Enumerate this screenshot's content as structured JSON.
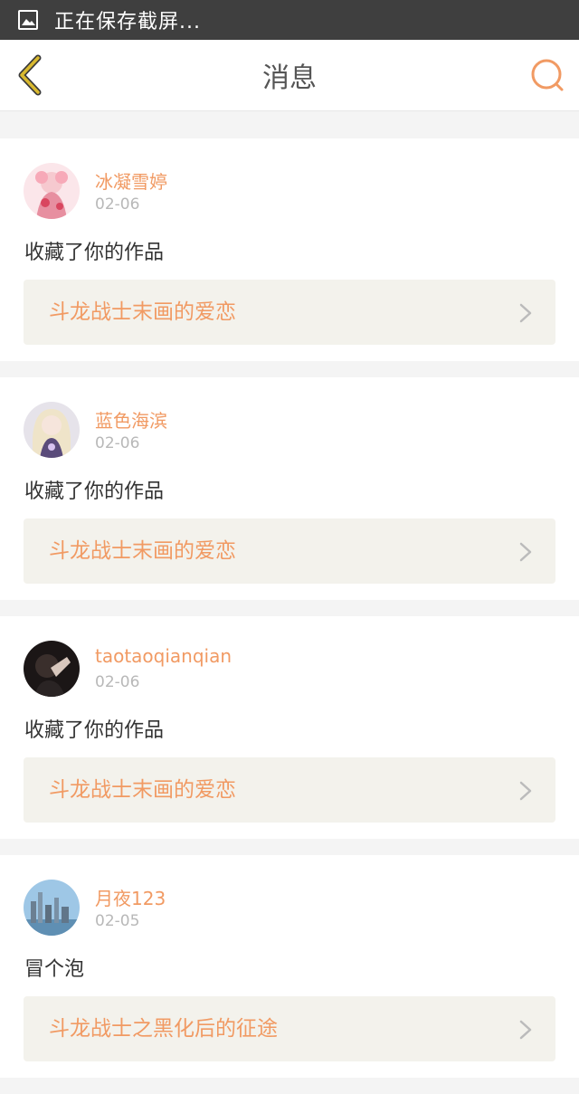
{
  "status_bar": {
    "text": "正在保存截屏..."
  },
  "nav": {
    "title": "消息",
    "back_icon": "chevron-left-icon",
    "search_icon": "search-icon"
  },
  "colors": {
    "accent": "#f19a63",
    "back_arrow": "#d9b92f",
    "card_link_bg": "#f3f2ec"
  },
  "messages": [
    {
      "user": "冰凝雪婷",
      "date": "02-06",
      "text": "收藏了你的作品",
      "work": "斗龙战士末画的爱恋"
    },
    {
      "user": "蓝色海滨",
      "date": "02-06",
      "text": "收藏了你的作品",
      "work": "斗龙战士末画的爱恋"
    },
    {
      "user": "taotaoqianqian",
      "date": "02-06",
      "text": "收藏了你的作品",
      "work": "斗龙战士末画的爱恋"
    },
    {
      "user": "月夜123",
      "date": "02-05",
      "text": "冒个泡",
      "work": "斗龙战士之黑化后的征途"
    }
  ]
}
